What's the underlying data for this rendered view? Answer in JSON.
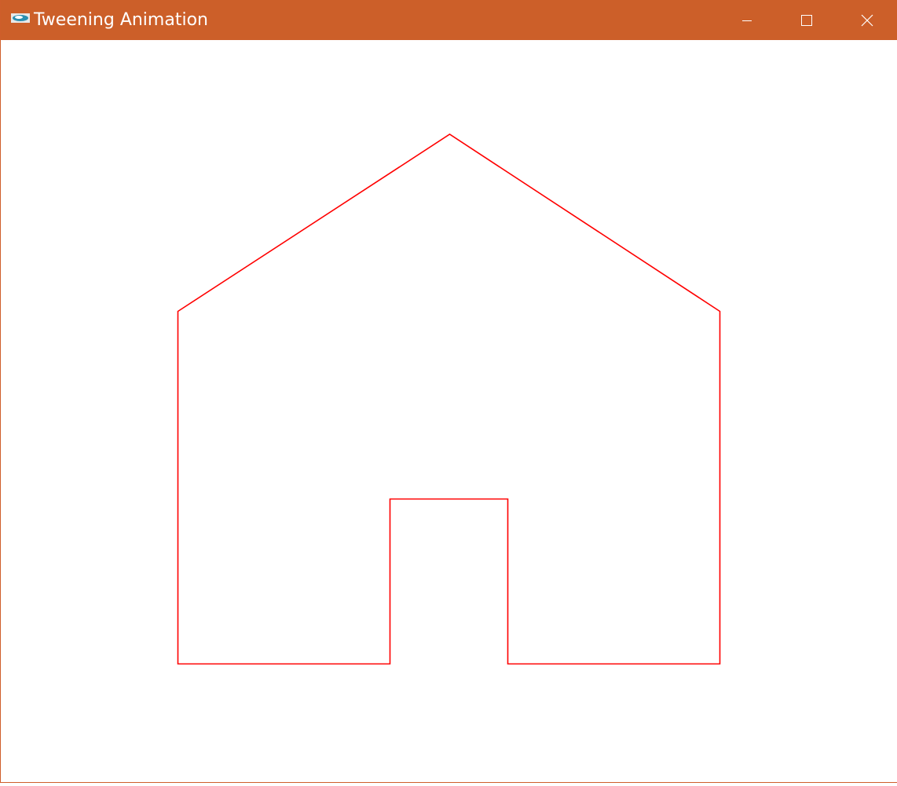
{
  "window": {
    "title": "Tweening Animation",
    "app_icon": "app-logo-icon",
    "titlebar_color": "#cc5f29",
    "controls": {
      "minimize": "minimize-icon",
      "maximize": "maximize-icon",
      "close": "close-icon"
    }
  },
  "canvas": {
    "background": "#ffffff",
    "stroke_color": "#ff0000",
    "shape": "house outline with door"
  }
}
